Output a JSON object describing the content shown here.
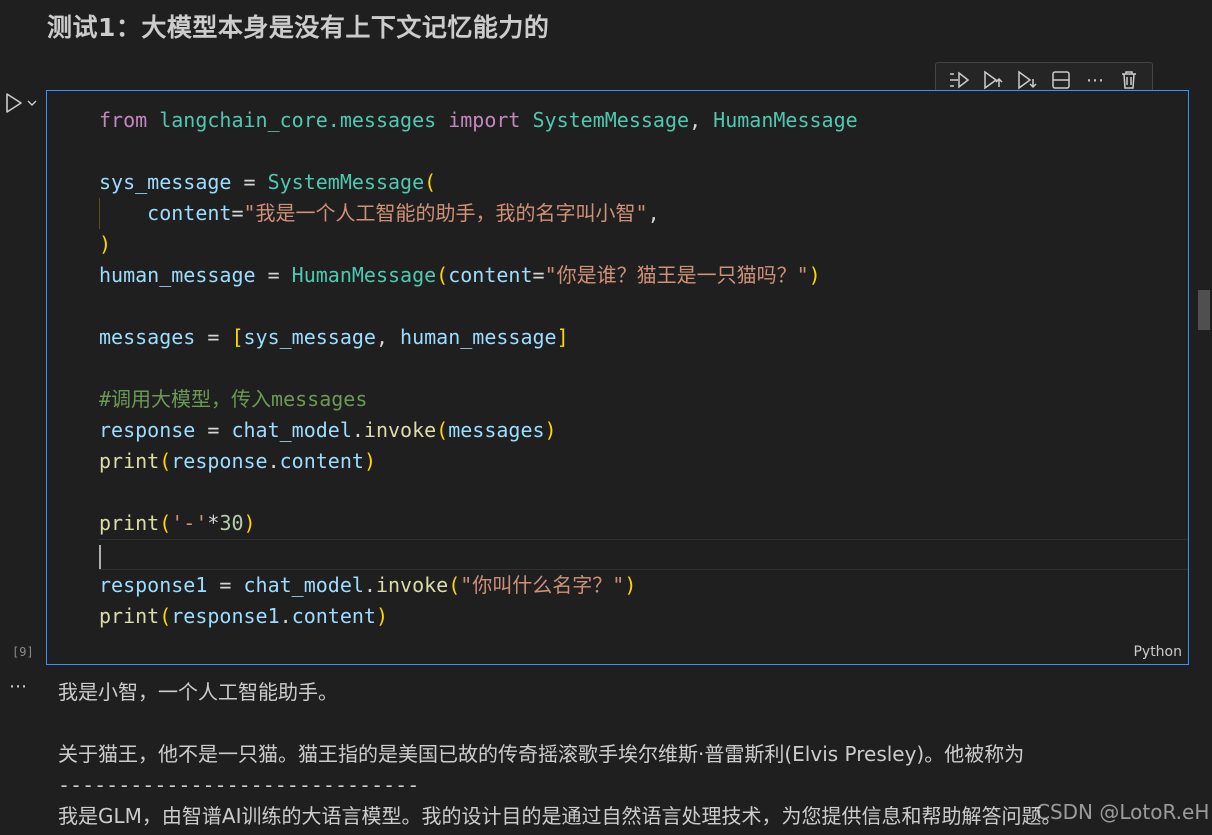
{
  "heading": "测试1：大模型本身是没有上下文记忆能力的",
  "cell": {
    "execution_count": "[9]",
    "language": "Python",
    "code": {
      "l1": {
        "from": "from",
        "module": "langchain_core.messages",
        "import": "import",
        "cls1": "SystemMessage",
        "comma": ", ",
        "cls2": "HumanMessage"
      },
      "l3": {
        "var": "sys_message",
        "eq": " = ",
        "cls": "SystemMessage",
        "paren": "("
      },
      "l4": {
        "indent": "    ",
        "arg": "content",
        "eq": "=",
        "str": "\"我是一个人工智能的助手，我的名字叫小智\"",
        "comma": ","
      },
      "l5": {
        "paren": ")"
      },
      "l6": {
        "var": "human_message",
        "eq": " = ",
        "cls": "HumanMessage",
        "po": "(",
        "arg": "content",
        "eq2": "=",
        "str": "\"你是谁？猫王是一只猫吗？\"",
        "pc": ")"
      },
      "l8": {
        "var": "messages",
        "eq": " = ",
        "bo": "[",
        "a": "sys_message",
        "comma": ", ",
        "b": "human_message",
        "bc": "]"
      },
      "l10": {
        "comment": "#调用大模型，传入messages"
      },
      "l11": {
        "var": "response",
        "eq": " = ",
        "obj": "chat_model",
        "dot": ".",
        "fn": "invoke",
        "po": "(",
        "arg": "messages",
        "pc": ")"
      },
      "l12": {
        "fn": "print",
        "po": "(",
        "obj": "response",
        "dot": ".",
        "attr": "content",
        "pc": ")"
      },
      "l14": {
        "fn": "print",
        "po": "(",
        "str": "'-'",
        "op": "*",
        "num": "30",
        "pc": ")"
      },
      "l16": {
        "var": "response1",
        "eq": " = ",
        "obj": "chat_model",
        "dot": ".",
        "fn": "invoke",
        "po": "(",
        "str": "\"你叫什么名字？\"",
        "pc": ")"
      },
      "l17": {
        "fn": "print",
        "po": "(",
        "obj": "response1",
        "dot": ".",
        "attr": "content",
        "pc": ")"
      }
    }
  },
  "toolbar": {
    "icons": [
      "run-by-line-icon",
      "execute-above-icon",
      "execute-below-icon",
      "split-cell-icon",
      "more-icon",
      "delete-icon"
    ],
    "more_label": "⋯"
  },
  "output": {
    "dots": "⋯",
    "line1": "我是小智，一个人工智能助手。",
    "line3": "关于猫王，他不是一只猫。猫王指的是美国已故的传奇摇滚歌手埃尔维斯·普雷斯利(Elvis Presley)。他被称为",
    "line4": "------------------------------",
    "line5": "我是GLM，由智谱AI训练的大语言模型。我的设计目的是通过自然语言处理技术，为您提供信息和帮助解答问题。"
  },
  "watermark": "CSDN @LotoR.eH",
  "colors": {
    "cell_border": "#3794ff",
    "background": "#1f1f1f",
    "keyword": "#c586c0",
    "class": "#4ec9b0",
    "variable": "#9cdcfe",
    "function": "#dcdcaa",
    "string": "#ce9178",
    "comment": "#6a9955"
  }
}
